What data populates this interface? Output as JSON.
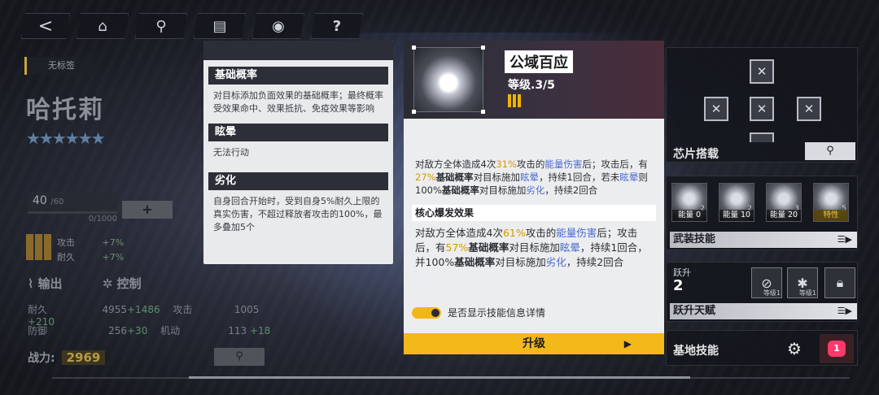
{
  "nav": {
    "back": "<",
    "help": "?"
  },
  "character": {
    "tag": "无标签",
    "name": "哈托莉",
    "stars": "★★★★★★",
    "level": "40",
    "level_max": "/60",
    "exp": "0/1000",
    "plus": "+",
    "bonus_atk_label": "攻击",
    "bonus_atk_value": "+7%",
    "bonus_dur_label": "耐久",
    "bonus_dur_value": "+7%",
    "tab_output": "输出",
    "tab_control": "控制",
    "stats": [
      {
        "label": "耐久",
        "value": "4955",
        "bonus": "+1486",
        "label2": "攻击",
        "value2": "1005",
        "bonus2": "+210"
      },
      {
        "label": "防御",
        "value": "256",
        "bonus": "+30",
        "label2": "机动",
        "value2": "113",
        "bonus2": "+18"
      }
    ],
    "power_label": "战力:",
    "power_value": "2969"
  },
  "tooltip": {
    "sections": [
      {
        "title": "基础概率",
        "text": "对目标添加负面效果的基础概率；最终概率受效果命中、效果抵抗、免疫效果等影响"
      },
      {
        "title": "眩晕",
        "text": "无法行动"
      },
      {
        "title": "劣化",
        "text": "自身回合开始时，受到自身5%耐久上限的真实伤害，不超过释放者攻击的100%，最多叠加5个"
      }
    ]
  },
  "skill": {
    "name": "公域百应",
    "level": "等级.3/5",
    "desc_parts": [
      "对敌方全体造成4次",
      "31%",
      "攻击的",
      "能量伤害",
      "后；攻击后，有",
      "27%",
      "基础概率",
      "对目标施加",
      "眩晕",
      "，持续1回合，若未",
      "眩晕",
      "则100%",
      "基础概率",
      "对目标施加",
      "劣化",
      "，持续2回合"
    ],
    "core_title": "核心爆发效果",
    "core_parts": [
      "对敌方全体造成4次",
      "61%",
      "攻击的",
      "能量伤害",
      "后；攻击后，有",
      "57%",
      "基础概率",
      "对目标施加",
      "眩晕",
      "，持续1回合，并100%",
      "基础概率",
      "对目标施加",
      "劣化",
      "，持续2回合"
    ],
    "toggle_label": "是否显示技能信息详情",
    "upgrade_label": "升级"
  },
  "right": {
    "chip_label": "芯片搭载",
    "arm_skills": [
      {
        "level": "2",
        "energy": "能量 0"
      },
      {
        "level": "2",
        "energy": "能量 10"
      },
      {
        "level": "3",
        "energy": "能量 20"
      },
      {
        "level": "5",
        "energy": "特性"
      }
    ],
    "arm_label": "武装技能",
    "jump_label": "跃升",
    "jump_value": "2",
    "jump_slots": [
      {
        "level": "等级1"
      },
      {
        "level": "等级1"
      }
    ],
    "jump_talent_label": "跃升天赋",
    "base_label": "基地技能",
    "heart_count": "1"
  }
}
